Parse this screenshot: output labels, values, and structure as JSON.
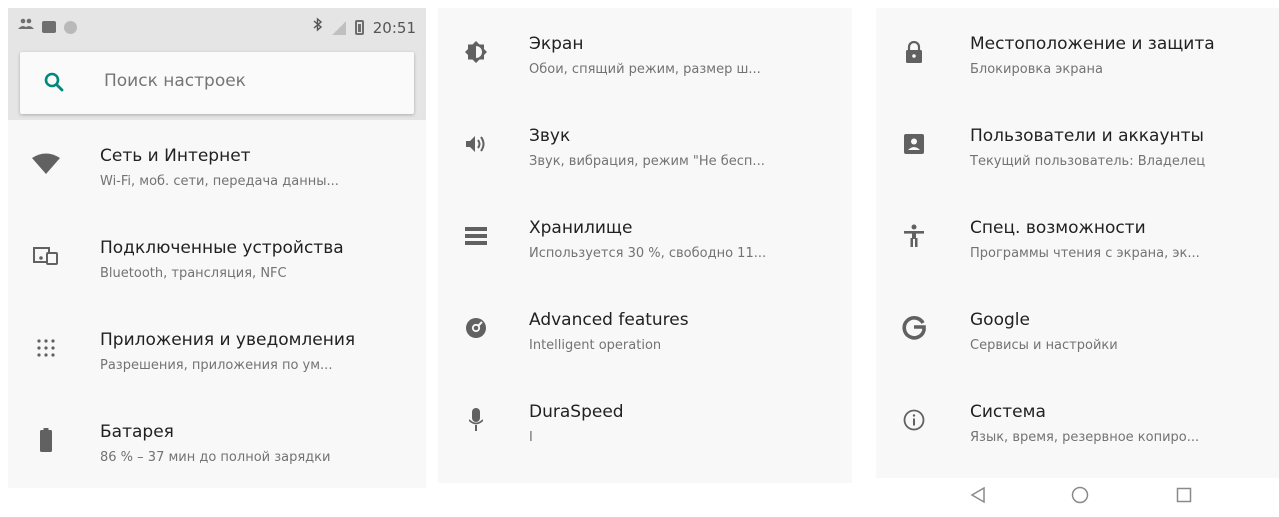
{
  "status_bar": {
    "time": "20:51"
  },
  "search": {
    "placeholder": "Поиск настроек"
  },
  "settings_left": [
    {
      "title": "Сеть и Интернет",
      "subtitle": "Wi-Fi, моб. сети, передача данны...",
      "icon": "wifi-icon"
    },
    {
      "title": "Подключенные устройства",
      "subtitle": "Bluetooth, трансляция, NFC",
      "icon": "devices-icon"
    },
    {
      "title": "Приложения и уведомления",
      "subtitle": "Разрешения, приложения по ум...",
      "icon": "apps-icon"
    },
    {
      "title": "Батарея",
      "subtitle": "86 % – 37 мин до полной зарядки",
      "icon": "battery-icon"
    }
  ],
  "settings_mid": [
    {
      "title": "Экран",
      "subtitle": "Обои, спящий режим, размер ш...",
      "icon": "brightness-icon"
    },
    {
      "title": "Звук",
      "subtitle": "Звук, вибрация, режим \"Не бесп...",
      "icon": "volume-icon"
    },
    {
      "title": "Хранилище",
      "subtitle": "Используется 30 %, свободно 11...",
      "icon": "storage-icon"
    },
    {
      "title": "Advanced features",
      "subtitle": "Intelligent operation",
      "icon": "advanced-features-icon"
    },
    {
      "title": "DuraSpeed",
      "subtitle": "I",
      "icon": "duraspeed-icon"
    }
  ],
  "settings_right": [
    {
      "title": "Местоположение и защита",
      "subtitle": "Блокировка экрана",
      "icon": "lock-icon"
    },
    {
      "title": "Пользователи и аккаунты",
      "subtitle": "Текущий пользователь: Владелец",
      "icon": "account-icon"
    },
    {
      "title": "Спец. возможности",
      "subtitle": "Программы чтения с экрана, эк...",
      "icon": "accessibility-icon"
    },
    {
      "title": "Google",
      "subtitle": "Сервисы и настройки",
      "icon": "google-icon"
    },
    {
      "title": "Система",
      "subtitle": "Язык, время, резервное копиро...",
      "icon": "info-icon"
    }
  ],
  "colors": {
    "accent": "#00897b",
    "icon_gray": "#616161",
    "status_bar_bg": "#e5e5e5"
  }
}
